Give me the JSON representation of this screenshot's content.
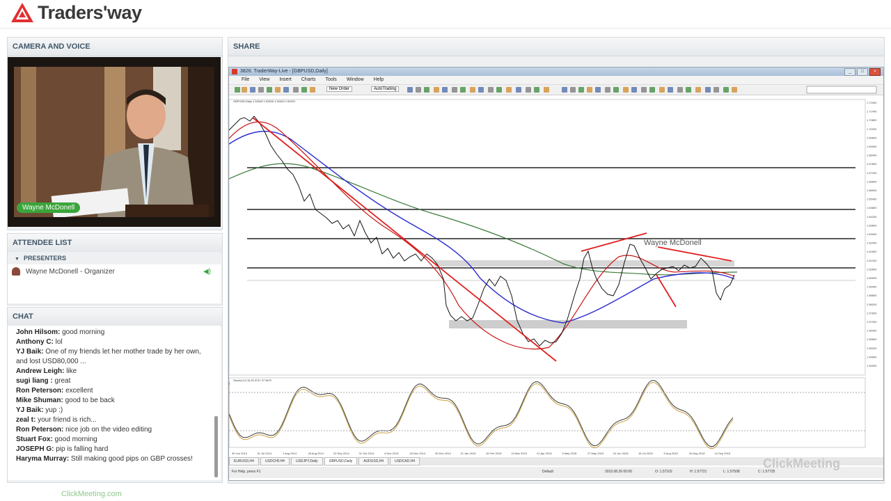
{
  "brand": {
    "name": "Traders'way"
  },
  "camera_panel": {
    "title": "CAMERA AND VOICE",
    "presenter_label": "Wayne McDonell"
  },
  "attendee_panel": {
    "title": "ATTENDEE LIST",
    "group_label": "PRESENTERS",
    "members": [
      {
        "name": "Wayne McDonell - Organizer"
      }
    ]
  },
  "chat_panel": {
    "title": "CHAT",
    "messages": [
      {
        "user": "John Hilsom:",
        "text": " good morning"
      },
      {
        "user": "Anthony C:",
        "text": " lol"
      },
      {
        "user": "YJ Baik:",
        "text": " One of my friends let her mother trade by her own, and lost USD80,000 ..."
      },
      {
        "user": "Andrew Leigh:",
        "text": " like"
      },
      {
        "user": "sugi liang :",
        "text": " great"
      },
      {
        "user": "Ron Peterson:",
        "text": " excellent"
      },
      {
        "user": "Mike Shuman:",
        "text": " good to be back"
      },
      {
        "user": "YJ Baik:",
        "text": " yup  :)"
      },
      {
        "user": "zeal t:",
        "text": " your friend is rich..."
      },
      {
        "user": "Ron Peterson:",
        "text": " nice job on the video editing"
      },
      {
        "user": "Stuart Fox:",
        "text": " good morning"
      },
      {
        "user": "JOSEPH G:",
        "text": " pip is falling hard"
      },
      {
        "user": "Haryma Murray:",
        "text": " Still making good pips on GBP crosses!"
      }
    ]
  },
  "share_panel": {
    "title": "SHARE"
  },
  "mt4": {
    "window_title": "3826: TraderWay-Live - [GBPUSD,Daily]",
    "menu": [
      "File",
      "View",
      "Insert",
      "Charts",
      "Tools",
      "Window",
      "Help"
    ],
    "toolbar": {
      "new_order": "New Order",
      "autotrading": "AutoTrading"
    },
    "chart_header": "GBPUSD,Daily 1.52645 1.52826 1.52403 1.52631",
    "osc_header": "Stoch(14,3,3) 25.3747 27.5672",
    "chart_overlay_text": "Wayne McDonell",
    "tabs": [
      "EURUSD,H4",
      "USDCHF,H4",
      "USDJPY,Daily",
      "GBPUSD,Daily",
      "AUDUSD,H4",
      "USDCAD,H4"
    ],
    "active_tab": "GBPUSD,Daily",
    "status": {
      "help": "For Help, press F1",
      "profile": "Default",
      "datetime": "2015.08.26 00:00",
      "open": "O: 1.57102",
      "high": "H: 1.57721",
      "low": "L: 1.57508",
      "close": "C: 1.57725"
    },
    "price_ticks": [
      "1.72000",
      "1.71400",
      "1.70800",
      "1.70200",
      "1.69600",
      "1.69000",
      "1.68400",
      "1.67800",
      "1.67200",
      "1.66600",
      "1.66000",
      "1.65400",
      "1.64800",
      "1.64200",
      "1.63600",
      "1.63000",
      "1.62400",
      "1.61800",
      "1.61200",
      "1.60600",
      "1.60000",
      "1.59400",
      "1.58800",
      "1.58200",
      "1.57600",
      "1.57000",
      "1.56400",
      "1.55800",
      "1.55200",
      "1.54600",
      "1.54000"
    ],
    "date_ticks": [
      "30 Jun 2014",
      "31 Jul 2014",
      "1 Aug 2014",
      "28 Aug 2014",
      "29 Sep 2014",
      "31 Oct 2014",
      "4 Nov 2014",
      "26 Nov 2014",
      "30 Dec 2014",
      "21 Jan 2015",
      "16 Feb 2015",
      "24 Mar 2015",
      "21 Apr 2015",
      "5 May 2015",
      "27 May 2015",
      "24 Jun 2015",
      "16 Jul 2015",
      "5 Aug 2015",
      "26 Aug 2015",
      "14 Sep 2015"
    ]
  },
  "footer": {
    "text": "ClickMeeting.com",
    "watermark": "ClickMeeting"
  },
  "colors": {
    "accent": "#3aa53a",
    "panel_header_text": "#3f5668",
    "trend": "#e01e1e",
    "ma_blue": "#2a2ad0",
    "ma_green": "#3a7a3a"
  }
}
